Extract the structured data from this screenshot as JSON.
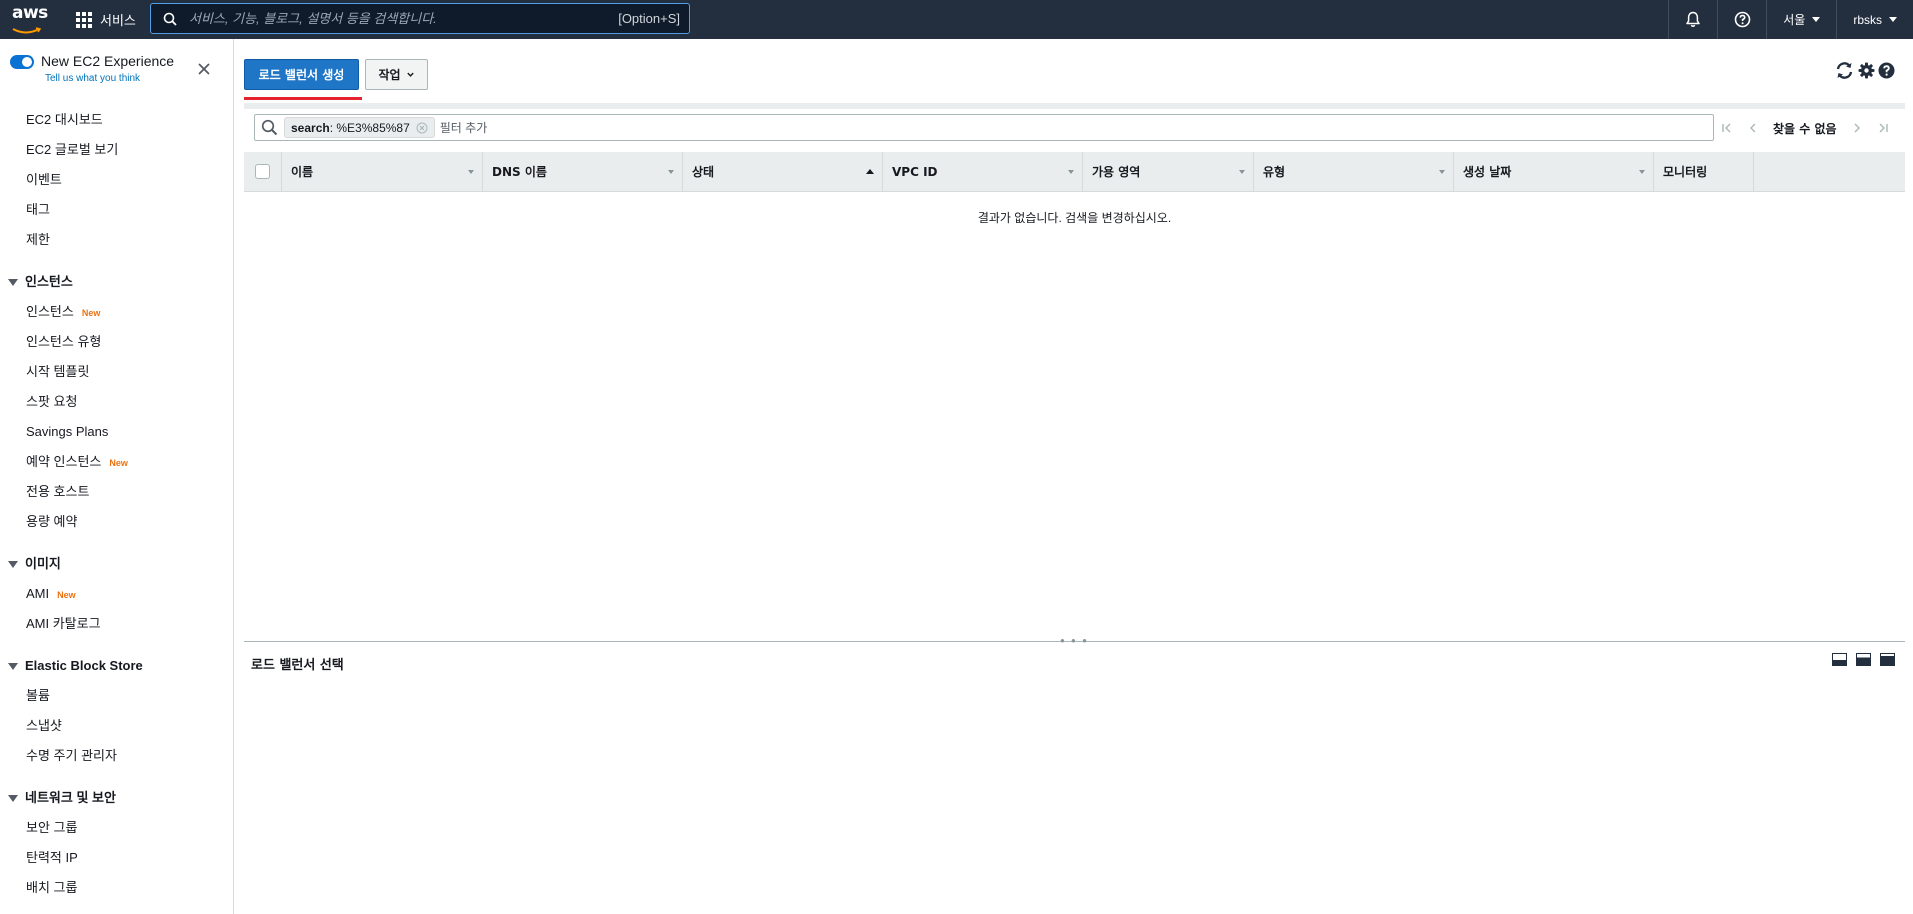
{
  "topnav": {
    "logo_text": "aws",
    "services_label": "서비스",
    "search_placeholder": "서비스, 기능, 블로그, 설명서 등을 검색합니다.",
    "search_shortcut": "[Option+S]",
    "region_label": "서울",
    "account_label": "rbsks",
    "icons": [
      "bell-icon",
      "help-icon"
    ]
  },
  "sidebar": {
    "toggle_title": "New EC2 Experience",
    "feedback_link": "Tell us what you think",
    "top_items": [
      {
        "label": "EC2 대시보드"
      },
      {
        "label": "EC2 글로벌 보기"
      },
      {
        "label": "이벤트"
      },
      {
        "label": "태그"
      },
      {
        "label": "제한"
      }
    ],
    "sections": [
      {
        "title": "인스턴스",
        "items": [
          {
            "label": "인스턴스",
            "badge": "New"
          },
          {
            "label": "인스턴스 유형",
            "badge": ""
          },
          {
            "label": "시작 템플릿",
            "badge": ""
          },
          {
            "label": "스팟 요청",
            "badge": ""
          },
          {
            "label": "Savings Plans",
            "badge": ""
          },
          {
            "label": "예약 인스턴스",
            "badge": "New"
          },
          {
            "label": "전용 호스트",
            "badge": ""
          },
          {
            "label": "용량 예약",
            "badge": ""
          }
        ]
      },
      {
        "title": "이미지",
        "items": [
          {
            "label": "AMI",
            "badge": "New"
          },
          {
            "label": "AMI 카탈로그",
            "badge": ""
          }
        ]
      },
      {
        "title": "Elastic Block Store",
        "items": [
          {
            "label": "볼륨",
            "badge": ""
          },
          {
            "label": "스냅샷",
            "badge": ""
          },
          {
            "label": "수명 주기 관리자",
            "badge": ""
          }
        ]
      },
      {
        "title": "네트워크 및 보안",
        "items": [
          {
            "label": "보안 그룹",
            "badge": ""
          },
          {
            "label": "탄력적 IP",
            "badge": ""
          },
          {
            "label": "배치 그룹",
            "badge": ""
          }
        ]
      }
    ]
  },
  "toolbar": {
    "create_button": "로드 밸런서 생성",
    "actions_button": "작업"
  },
  "filter": {
    "token_key": "search",
    "token_value": " : %E3%85%87",
    "add_filter": "필터 추가"
  },
  "pager": {
    "status": "찾을 수 없음"
  },
  "table": {
    "columns": [
      "이름",
      "DNS 이름",
      "상태",
      "VPC ID",
      "가용 영역",
      "유형",
      "생성 날짜",
      "모니터링"
    ],
    "sorted_column": "상태",
    "empty_message": "결과가 없습니다. 검색을 변경하십시오."
  },
  "detail": {
    "title": "로드 밸런서 선택"
  },
  "colors": {
    "nav_bg": "#232f3e",
    "primary": "#1f75c6",
    "accent_underline": "#e4232f",
    "badge_new": "#ec7211"
  }
}
